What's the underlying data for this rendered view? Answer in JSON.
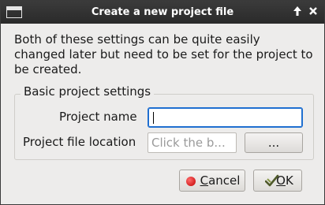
{
  "dialog": {
    "title": "Create a new project file",
    "keep_above_glyph": "🠕",
    "close_glyph": "✕"
  },
  "description": "Both of these settings can be quite easily changed later but need to be set for the project to be created.",
  "group": {
    "title": "Basic project settings",
    "project_name_label": "Project name",
    "project_name_value": "",
    "project_file_location_label": "Project file location",
    "project_file_location_placeholder": "Click the b...",
    "browse_label": "..."
  },
  "buttons": {
    "cancel_prefix": "",
    "cancel_mnemonic": "C",
    "cancel_rest": "ancel",
    "ok_mnemonic": "O",
    "ok_rest": "K"
  },
  "icons": {
    "window_menu": "window-menu-icon",
    "cancel": "cancel-icon",
    "ok": "ok-icon"
  },
  "colors": {
    "titlebar": "#2f2f2f",
    "focus": "#1f6fd0",
    "cancel_icon": "#d40000",
    "ok_icon": "#6b7a3a"
  }
}
